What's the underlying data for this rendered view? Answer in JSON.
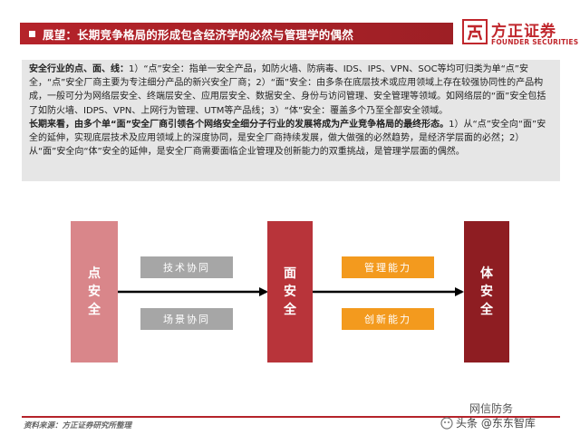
{
  "header": {
    "title": "展望：长期竞争格局的形成包含经济学的必然与管理学的偶然",
    "logo_cn": "方正证券",
    "logo_en": "FOUNDER SECURITIES"
  },
  "summary": {
    "p1_lead": "安全行业的点、面、线：",
    "p1_body": "1）“点”安全：指单一安全产品，如防火墙、防病毒、IDS、IPS、VPN、SOC等均可归类为单“点”安全，“点”安全厂商主要为专注细分产品的新兴安全厂商；2）“面”安全：由多条在底层技术或应用领域上存在较强协同性的产品构成，一般可分为网络层安全、终端层安全、应用层安全、数据安全、身份与访问管理、安全管理等领域。如网络层的“面”安全包括了如防火墙、IDPS、VPN、上网行为管理、UTM等产品线；3）“体”安全：覆盖多个乃至全部安全领域。",
    "p2_lead": "长期来看，由多个单“面”安全厂商引领各个网络安全细分子行业的发展将成为产业竞争格局的最终形态。",
    "p2_body": "1）从“点”安全向“面”安全的延伸，实现底层技术及应用领域上的深度协同，是安全厂商持续发展，做大做强的必然趋势，是经济学层面的必然；2）从“面”安全向“体”安全的延伸，是安全厂商需要面临企业管理及创新能力的双重挑战，是管理学层面的偶然。"
  },
  "diagram": {
    "block_point": "点安全",
    "block_surface": "面安全",
    "block_body": "体安全",
    "tag_tech": "技术协同",
    "tag_scene": "场景协同",
    "tag_mgmt": "管理能力",
    "tag_innov": "创新能力"
  },
  "footer": {
    "source": "资料来源：方正证券研究所整理",
    "watermark_title": "网信防务",
    "watermark": "头条 @东东智库"
  },
  "colors": {
    "brand_red": "#b5232a",
    "block_light": "#d9868a",
    "block_mid": "#b8343a",
    "block_dark": "#8e1d22",
    "tag_gray": "#a6a6a6",
    "tag_orange": "#f39a1e"
  }
}
